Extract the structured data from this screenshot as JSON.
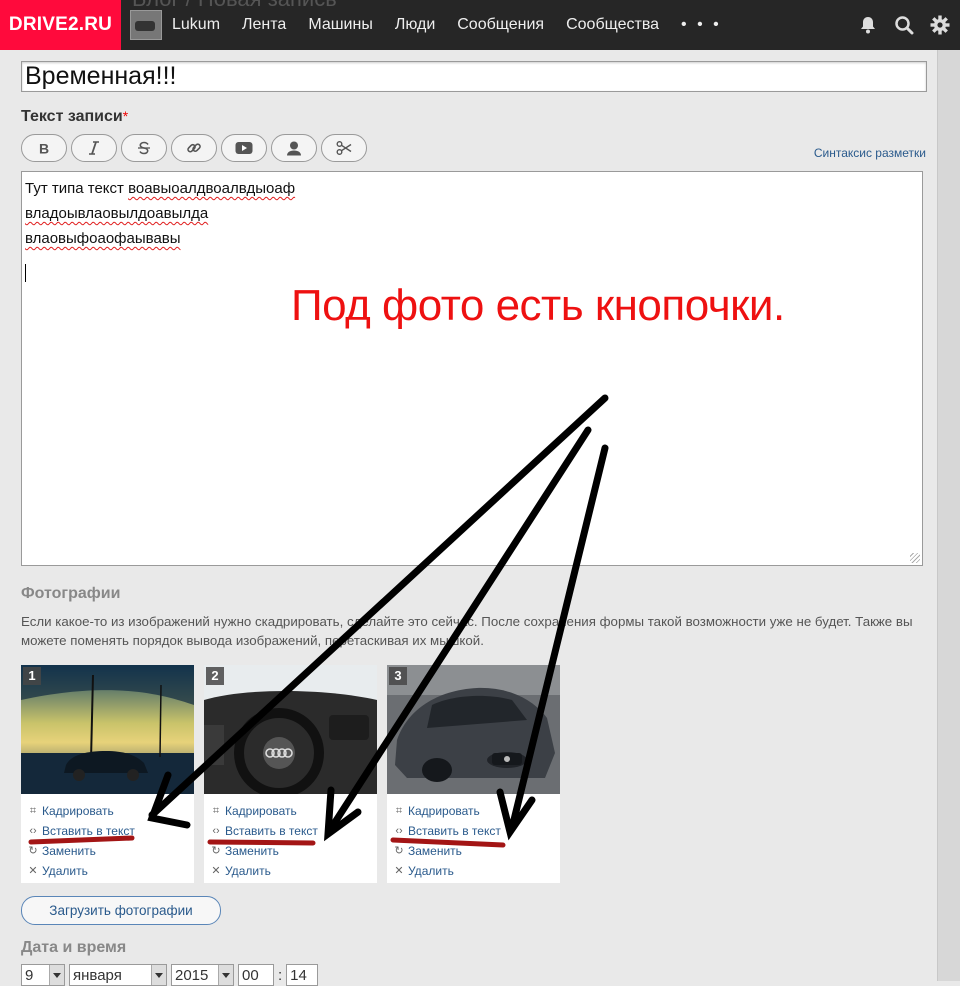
{
  "topbar": {
    "logo": "DRIVE2.RU",
    "page_title_behind": "Блог / Новая запись",
    "user_name": "Lukum",
    "nav": [
      "Лента",
      "Машины",
      "Люди",
      "Сообщения",
      "Сообщества"
    ],
    "more": "• • •",
    "icons": [
      "bell-icon",
      "search-icon",
      "gear-icon"
    ]
  },
  "form": {
    "title_value": "Временная!!!",
    "text_label": "Текст записи",
    "required_mark": "*",
    "toolbar": [
      "bold-icon",
      "italic-icon",
      "strikethrough-icon",
      "link-icon",
      "video-icon",
      "user-icon",
      "cut-icon"
    ],
    "syntax_link": "Синтаксис разметки",
    "editor_lines": [
      {
        "plain": "Тут типа текст ",
        "misspelled": "воавыоалдвоалвдыоаф"
      },
      {
        "plain": "",
        "misspelled": "владоывлаовылдоавылда"
      },
      {
        "plain": "",
        "misspelled": "влаовыфоаофаывавы"
      }
    ]
  },
  "photos": {
    "heading": "Фотографии",
    "description": "Если какое-то из изображений нужно скадрировать, сделайте это сейчас. После сохранения формы такой возможности уже не будет. Также вы можете поменять порядок вывода изображений, перетаскивая их мышкой.",
    "actions": {
      "crop": "Кадрировать",
      "insert": "Вставить в текст",
      "replace": "Заменить",
      "delete": "Удалить"
    },
    "cards": [
      {
        "number": "1"
      },
      {
        "number": "2"
      },
      {
        "number": "3"
      }
    ],
    "upload_button": "Загрузить фотографии"
  },
  "datetime": {
    "heading": "Дата и время",
    "day": "9",
    "month": "января",
    "year": "2015",
    "hour": "00",
    "colon": ":",
    "minute": "14"
  },
  "annotation": {
    "text": "Под фото есть кнопочки.",
    "color": "#ee1111"
  }
}
